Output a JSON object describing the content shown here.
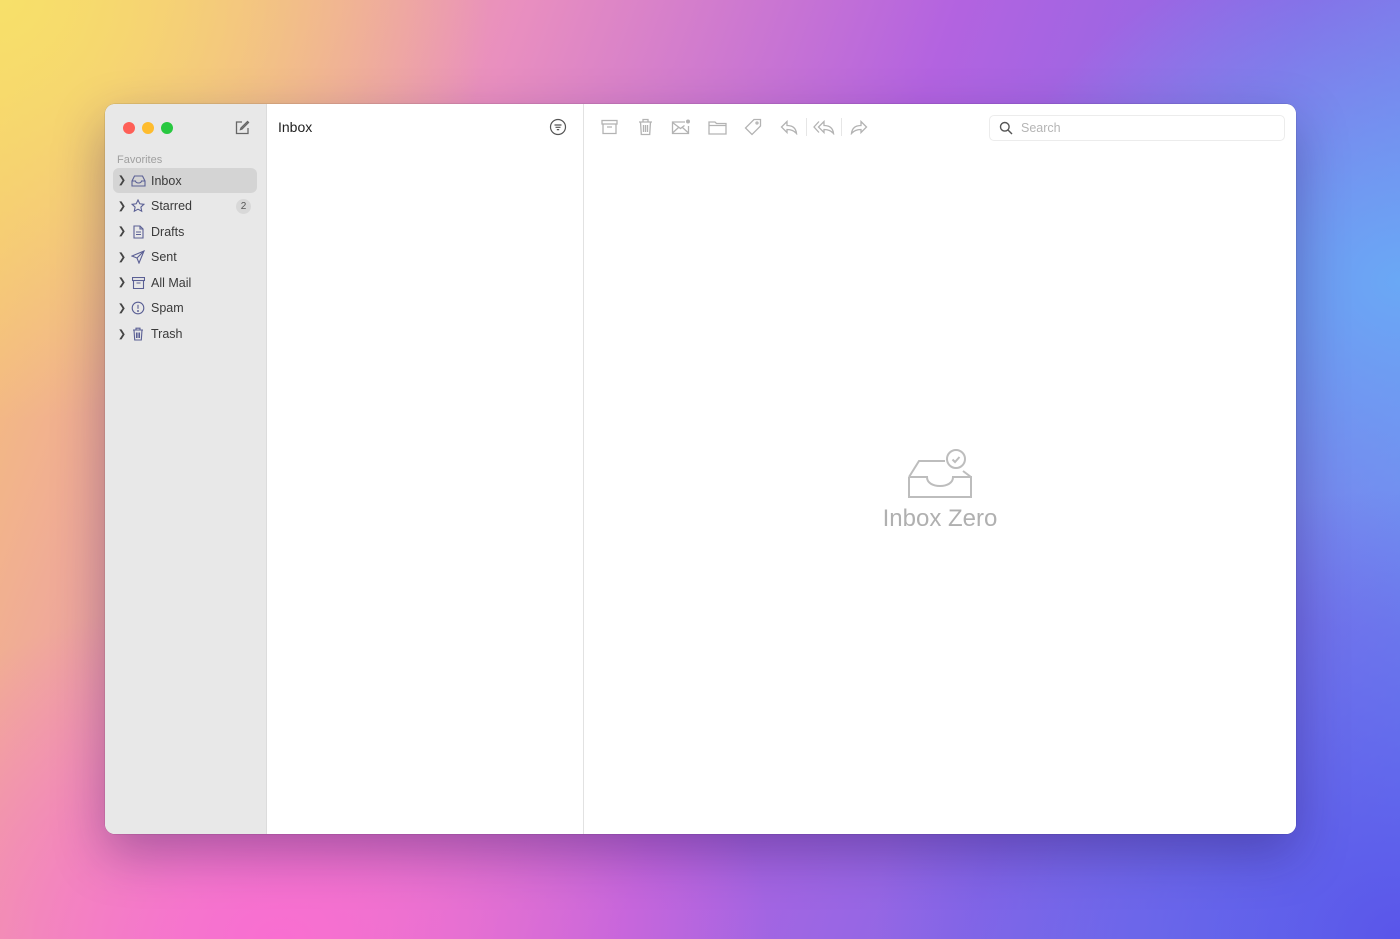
{
  "window": {
    "traffic_lights": [
      "close",
      "minimize",
      "maximize"
    ]
  },
  "sidebar": {
    "compose_icon": "compose-icon",
    "section_label": "Favorites",
    "items": [
      {
        "label": "Inbox",
        "icon": "inbox-icon",
        "active": true,
        "badge": null
      },
      {
        "label": "Starred",
        "icon": "star-icon",
        "active": false,
        "badge": "2"
      },
      {
        "label": "Drafts",
        "icon": "document-icon",
        "active": false,
        "badge": null
      },
      {
        "label": "Sent",
        "icon": "paper-plane-icon",
        "active": false,
        "badge": null
      },
      {
        "label": "All Mail",
        "icon": "archive-icon",
        "active": false,
        "badge": null
      },
      {
        "label": "Spam",
        "icon": "exclamation-circle-icon",
        "active": false,
        "badge": null
      },
      {
        "label": "Trash",
        "icon": "trash-icon",
        "active": false,
        "badge": null
      }
    ]
  },
  "list": {
    "title": "Inbox",
    "filter_icon": "filter-icon"
  },
  "toolbar": {
    "buttons": [
      "archive",
      "trash",
      "mark-unread",
      "move-to-folder",
      "tag",
      "reply",
      "reply-all",
      "forward"
    ]
  },
  "search": {
    "placeholder": "Search",
    "value": ""
  },
  "empty_state": {
    "title": "Inbox Zero",
    "icon": "inbox-check-icon"
  },
  "colors": {
    "close": "#fe5f57",
    "minimize": "#febc2e",
    "maximize": "#28c840",
    "sidebar_bg": "#e8e8e8",
    "active_item_bg": "#d4d4d4",
    "icon_accent": "#5a5f94"
  }
}
